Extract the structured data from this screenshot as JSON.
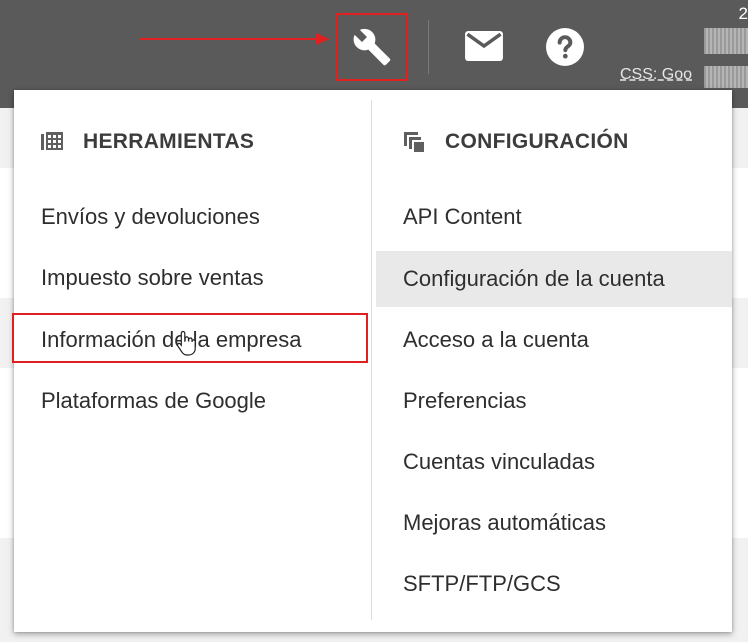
{
  "header": {
    "account_number_partial": "2",
    "css_label": "CSS: Goo",
    "tools_icon": "wrench-icon",
    "mail_icon": "mail-icon",
    "help_icon": "help-icon"
  },
  "menu": {
    "tools": {
      "title": "HERRAMIENTAS",
      "icon": "grid-table-icon",
      "items": [
        {
          "label": "Envíos y devoluciones"
        },
        {
          "label": "Impuesto sobre ventas"
        },
        {
          "label": "Información de la empresa"
        },
        {
          "label": "Plataformas de Google"
        }
      ]
    },
    "settings": {
      "title": "CONFIGURACIÓN",
      "icon": "stacked-squares-icon",
      "items": [
        {
          "label": "API Content"
        },
        {
          "label": "Configuración de la cuenta"
        },
        {
          "label": "Acceso a la cuenta"
        },
        {
          "label": "Preferencias"
        },
        {
          "label": "Cuentas vinculadas"
        },
        {
          "label": "Mejoras automáticas"
        },
        {
          "label": "SFTP/FTP/GCS"
        }
      ]
    }
  },
  "colors": {
    "header_bg": "#5a5a5a",
    "annotation": "#e02020",
    "hover_bg": "#e9e9e9"
  }
}
